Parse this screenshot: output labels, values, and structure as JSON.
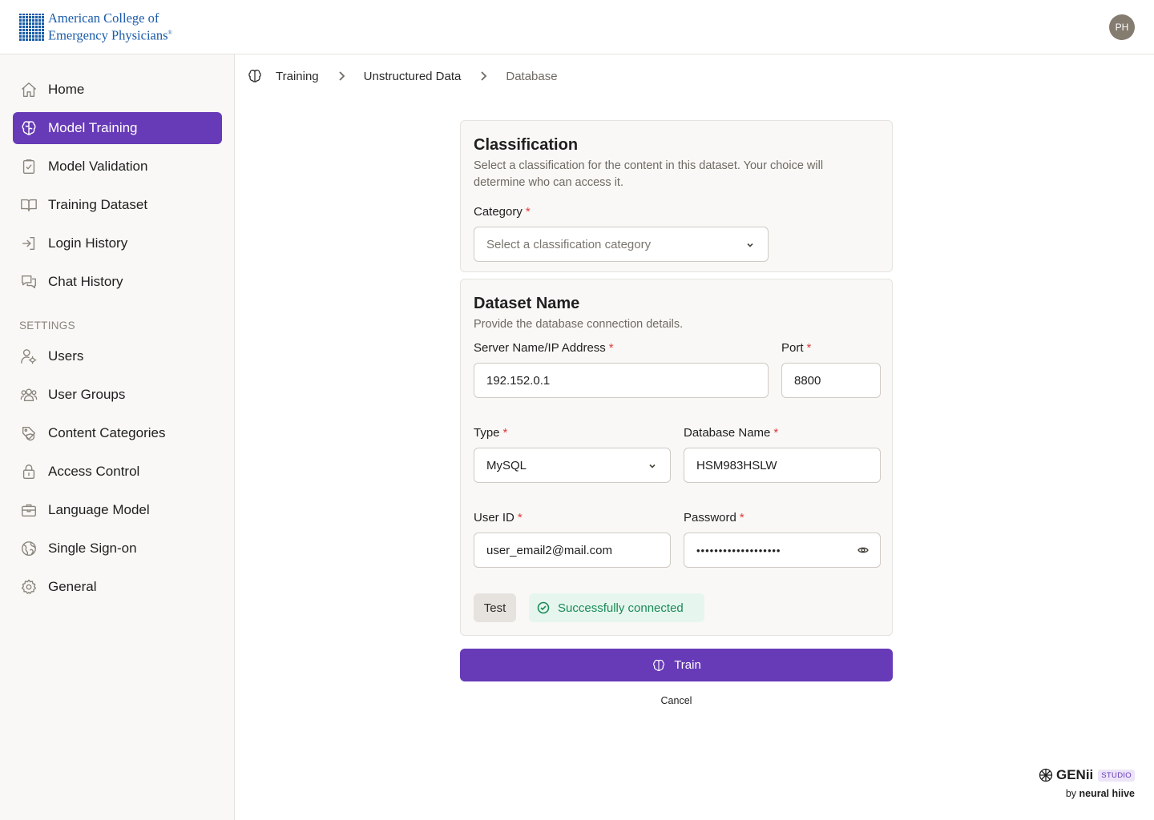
{
  "header": {
    "logo_line1": "American College of",
    "logo_line2": "Emergency Physicians",
    "logo_mark": "®",
    "avatar_initials": "PH"
  },
  "sidebar": {
    "items": [
      {
        "label": "Home",
        "icon": "home-icon"
      },
      {
        "label": "Model Training",
        "icon": "brain-icon",
        "active": true
      },
      {
        "label": "Model Validation",
        "icon": "clipboard-check-icon"
      },
      {
        "label": "Training Dataset",
        "icon": "book-open-icon"
      },
      {
        "label": "Login History",
        "icon": "login-icon"
      },
      {
        "label": "Chat History",
        "icon": "chat-bubbles-icon"
      }
    ],
    "settings_label": "SETTINGS",
    "settings_items": [
      {
        "label": "Users",
        "icon": "user-gear-icon"
      },
      {
        "label": "User Groups",
        "icon": "users-icon"
      },
      {
        "label": "Content Categories",
        "icon": "tag-shield-icon"
      },
      {
        "label": "Access Control",
        "icon": "lock-icon"
      },
      {
        "label": "Language Model",
        "icon": "briefcase-icon"
      },
      {
        "label": "Single Sign-on",
        "icon": "globe-icon"
      },
      {
        "label": "General",
        "icon": "gear-icon"
      }
    ],
    "accent_color": "#673ab7"
  },
  "breadcrumb": {
    "items": [
      "Training",
      "Unstructured Data",
      "Database"
    ]
  },
  "classification": {
    "title": "Classification",
    "description": "Select a classification for the content in this dataset. Your choice will determine who can access it.",
    "category_label": "Category",
    "category_placeholder": "Select a classification category"
  },
  "dataset": {
    "title": "Dataset Name",
    "description": "Provide the database connection details.",
    "server_label": "Server Name/IP Address",
    "server_value": "192.152.0.1",
    "port_label": "Port",
    "port_value": "8800",
    "type_label": "Type",
    "type_value": "MySQL",
    "dbname_label": "Database Name",
    "dbname_value": "HSM983HSLW",
    "userid_label": "User ID",
    "userid_value": "user_email2@mail.com",
    "password_label": "Password",
    "password_value": "•••••••••••••••••••",
    "test_label": "Test",
    "status_text": "Successfully connected",
    "status_color": "#1a8a55"
  },
  "actions": {
    "train_label": "Train",
    "cancel_label": "Cancel"
  },
  "footer": {
    "brand_name": "GENii",
    "brand_badge": "STUDIO",
    "by_prefix": "by",
    "by_name": "neural hiive"
  }
}
